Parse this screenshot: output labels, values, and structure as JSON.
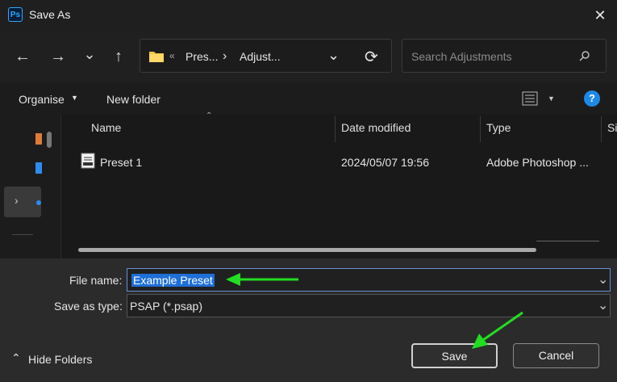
{
  "window": {
    "title": "Save As",
    "app_icon": "Ps",
    "close_glyph": "✕"
  },
  "nav": {
    "back_icon": "←",
    "forward_icon": "→",
    "recent_icon": "⌄",
    "up_icon": "↑",
    "breadcrumb": {
      "overflow": "«",
      "items": [
        "Pres...",
        "Adjust..."
      ],
      "sep": "›"
    },
    "dropdown_icon": "⌄",
    "refresh_icon": "⟳",
    "search_placeholder": "Search Adjustments"
  },
  "toolbar": {
    "organise_label": "Organise",
    "new_folder_label": "New folder",
    "help_glyph": "?"
  },
  "columns": [
    "Name",
    "Date modified",
    "Type",
    "Si"
  ],
  "files": [
    {
      "name": "Preset 1",
      "date": "2024/05/07 19:56",
      "type": "Adobe Photoshop ..."
    }
  ],
  "form": {
    "file_name_label": "File name:",
    "file_name_value": "Example Preset",
    "type_label": "Save as type:",
    "type_value": "PSAP (*.psap)"
  },
  "footer": {
    "hide_folders_label": "Hide Folders",
    "save_label": "Save",
    "cancel_label": "Cancel"
  },
  "colors": {
    "accent": "#1e6fd6",
    "annotation_arrow": "#22dd22",
    "help": "#1e88e5"
  }
}
